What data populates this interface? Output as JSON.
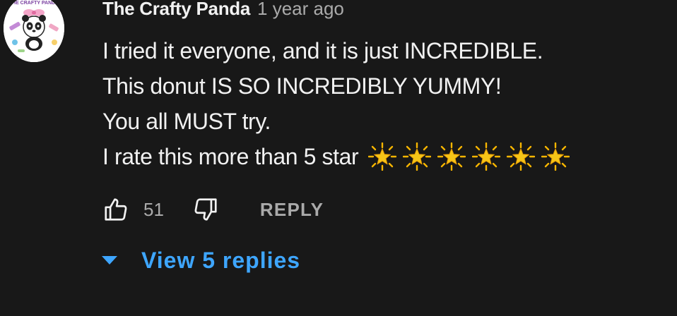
{
  "comment": {
    "author": "The Crafty Panda",
    "timestamp": "1 year ago",
    "avatar_text": "THE CRAFTY PANDA",
    "lines": [
      "I tried it everyone, and it is just INCREDIBLE.",
      "This donut IS SO INCREDIBLY YUMMY!",
      "You all MUST try.",
      "I rate this more than 5 star"
    ],
    "star_count": 6,
    "star_icon": "glowing-star-icon"
  },
  "actions": {
    "like_count": "51",
    "reply_label": "REPLY",
    "like_icon": "thumbs-up-icon",
    "dislike_icon": "thumbs-down-icon"
  },
  "replies": {
    "label": "View 5 replies",
    "icon": "caret-down-icon"
  },
  "colors": {
    "background": "#181818",
    "text": "#f1f1f1",
    "secondary_text": "#aaaaaa",
    "link": "#3ea6ff",
    "star": "#f5c518"
  }
}
